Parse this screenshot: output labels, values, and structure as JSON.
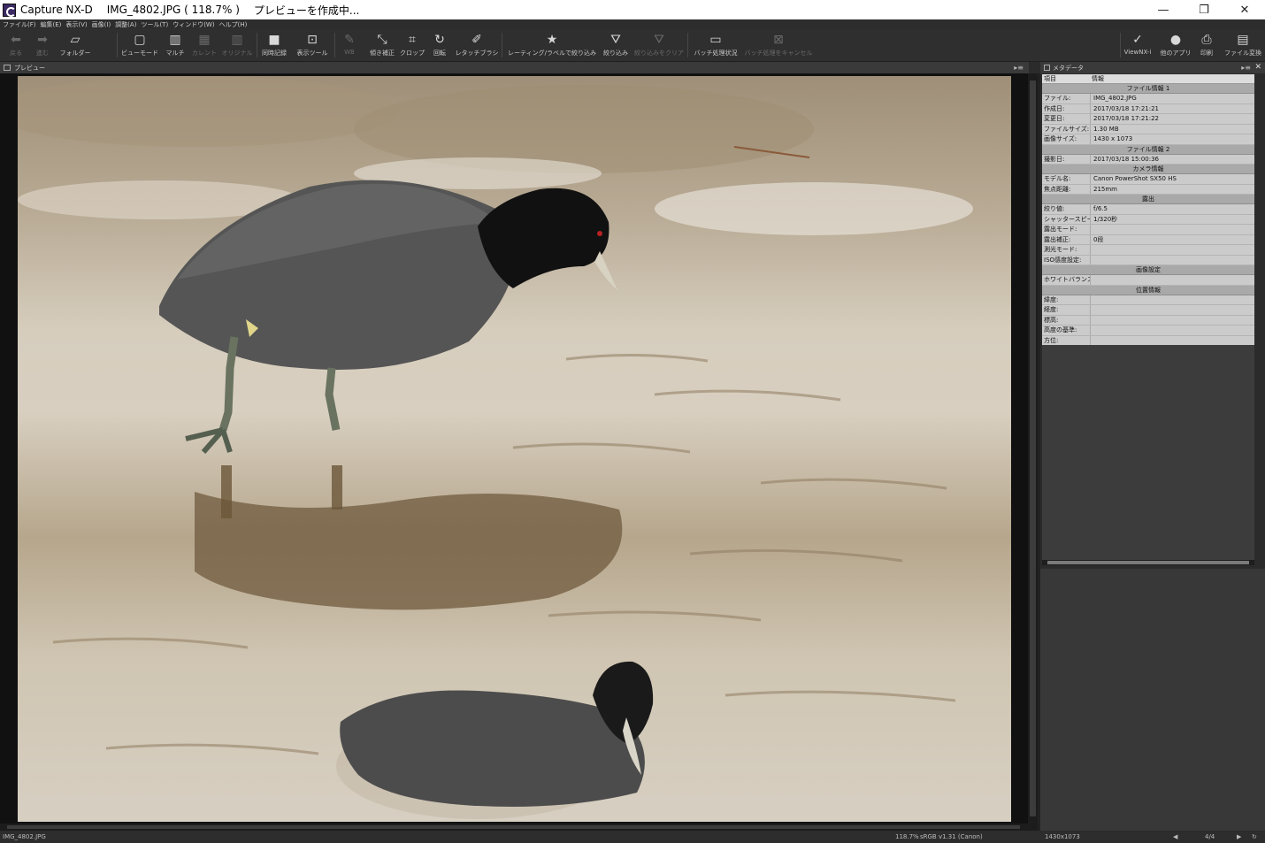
{
  "window": {
    "app_name": "Capture NX-D",
    "file_title": "IMG_4802.JPG ( 118.7% )",
    "status_title": "プレビューを作成中...",
    "controls": {
      "minimize": "—",
      "restore": "❐",
      "close": "✕"
    }
  },
  "menu": [
    "ファイル(F)",
    "編集(E)",
    "表示(V)",
    "画像(I)",
    "調整(A)",
    "ツール(T)",
    "ウィンドウ(W)",
    "ヘルプ(H)"
  ],
  "toolbar": {
    "back": "戻る",
    "forward": "進む",
    "folder": "フォルダー",
    "view_mode": "ビューモード",
    "multi": "マルチ",
    "current": "カレント",
    "original": "オリジナル",
    "sync_record": "同時記録",
    "display_tools": "表示ツール",
    "wb": "WB",
    "tilt": "傾き補正",
    "crop": "クロップ",
    "rotate": "回転",
    "retouch": "レタッチブラシ",
    "rating_filter": "レーティング/ラベルで絞り込み",
    "filter": "絞り込み",
    "clear_filter": "絞り込みをクリア",
    "batch_status": "バッチ処理状況",
    "batch_cancel": "バッチ処理をキャンセル",
    "viewnx": "ViewNX-i",
    "other_apps": "他のアプリ",
    "print": "印刷",
    "file_convert": "ファイル変換"
  },
  "preview": {
    "title": "プレビュー"
  },
  "metadata": {
    "title": "メタデータ",
    "col_item": "項目",
    "col_info": "情報",
    "sections": [
      {
        "title": "ファイル情報 1",
        "rows": [
          {
            "k": "ファイル:",
            "v": "IMG_4802.JPG"
          },
          {
            "k": "作成日:",
            "v": "2017/03/18 17:21:21"
          },
          {
            "k": "変更日:",
            "v": "2017/03/18 17:21:22"
          },
          {
            "k": "ファイルサイズ:",
            "v": "1.30 MB"
          },
          {
            "k": "画像サイズ:",
            "v": "1430 x 1073"
          }
        ]
      },
      {
        "title": "ファイル情報 2",
        "rows": [
          {
            "k": "撮影日:",
            "v": "2017/03/18 15:00:36"
          }
        ]
      },
      {
        "title": "カメラ情報",
        "rows": [
          {
            "k": "モデル名:",
            "v": "Canon PowerShot SX50 HS"
          },
          {
            "k": "焦点距離:",
            "v": "215mm"
          }
        ]
      },
      {
        "title": "露出",
        "rows": [
          {
            "k": "絞り値:",
            "v": "f/6.5"
          },
          {
            "k": "シャッタースピード:",
            "v": "1/320秒"
          },
          {
            "k": "露出モード:",
            "v": ""
          },
          {
            "k": "露出補正:",
            "v": "0段"
          },
          {
            "k": "測光モード:",
            "v": ""
          },
          {
            "k": "ISO感度設定:",
            "v": ""
          }
        ]
      },
      {
        "title": "画像設定",
        "rows": [
          {
            "k": "ホワイトバランス:",
            "v": ""
          }
        ]
      },
      {
        "title": "位置情報",
        "rows": [
          {
            "k": "緯度:",
            "v": ""
          },
          {
            "k": "経度:",
            "v": ""
          },
          {
            "k": "標高:",
            "v": ""
          },
          {
            "k": "高度の基準:",
            "v": ""
          },
          {
            "k": "方位:",
            "v": ""
          },
          {
            "k": "UTC:",
            "v": ""
          },
          {
            "k": "測地系:",
            "v": ""
          }
        ]
      }
    ]
  },
  "status": {
    "filename": "IMG_4802.JPG",
    "zoom": "118.7%",
    "profile": "sRGB v1.31 (Canon)",
    "size": "1430x1073",
    "page": "4/4"
  }
}
